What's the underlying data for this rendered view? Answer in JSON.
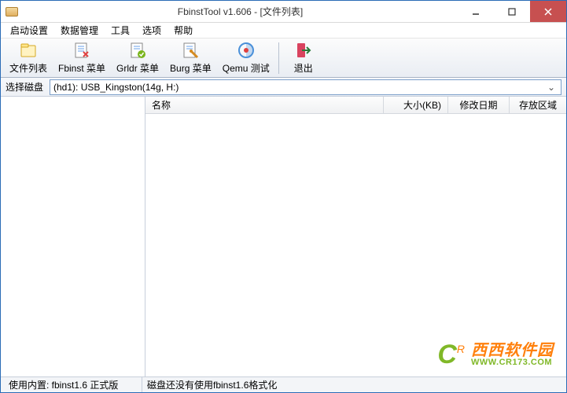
{
  "title": "FbinstTool v1.606 - [文件列表]",
  "menu": {
    "items": [
      "启动设置",
      "数据管理",
      "工具",
      "选项",
      "帮助"
    ]
  },
  "toolbar": {
    "file_list": "文件列表",
    "fbinst_menu": "Fbinst 菜单",
    "grldr_menu": "Grldr 菜单",
    "burg_menu": "Burg 菜单",
    "qemu_test": "Qemu 测试",
    "exit": "退出"
  },
  "disk": {
    "label": "选择磁盘",
    "selected": "(hd1): USB_Kingston(14g, H:)"
  },
  "columns": {
    "name": "名称",
    "size": "大小(KB)",
    "date": "修改日期",
    "area": "存放区域"
  },
  "status": {
    "kernel": "使用内置: fbinst1.6 正式版",
    "disk_msg": "磁盘还没有使用fbinst1.6格式化"
  },
  "watermark": {
    "cn": "西西软件园",
    "url": "WWW.CR173.COM"
  }
}
